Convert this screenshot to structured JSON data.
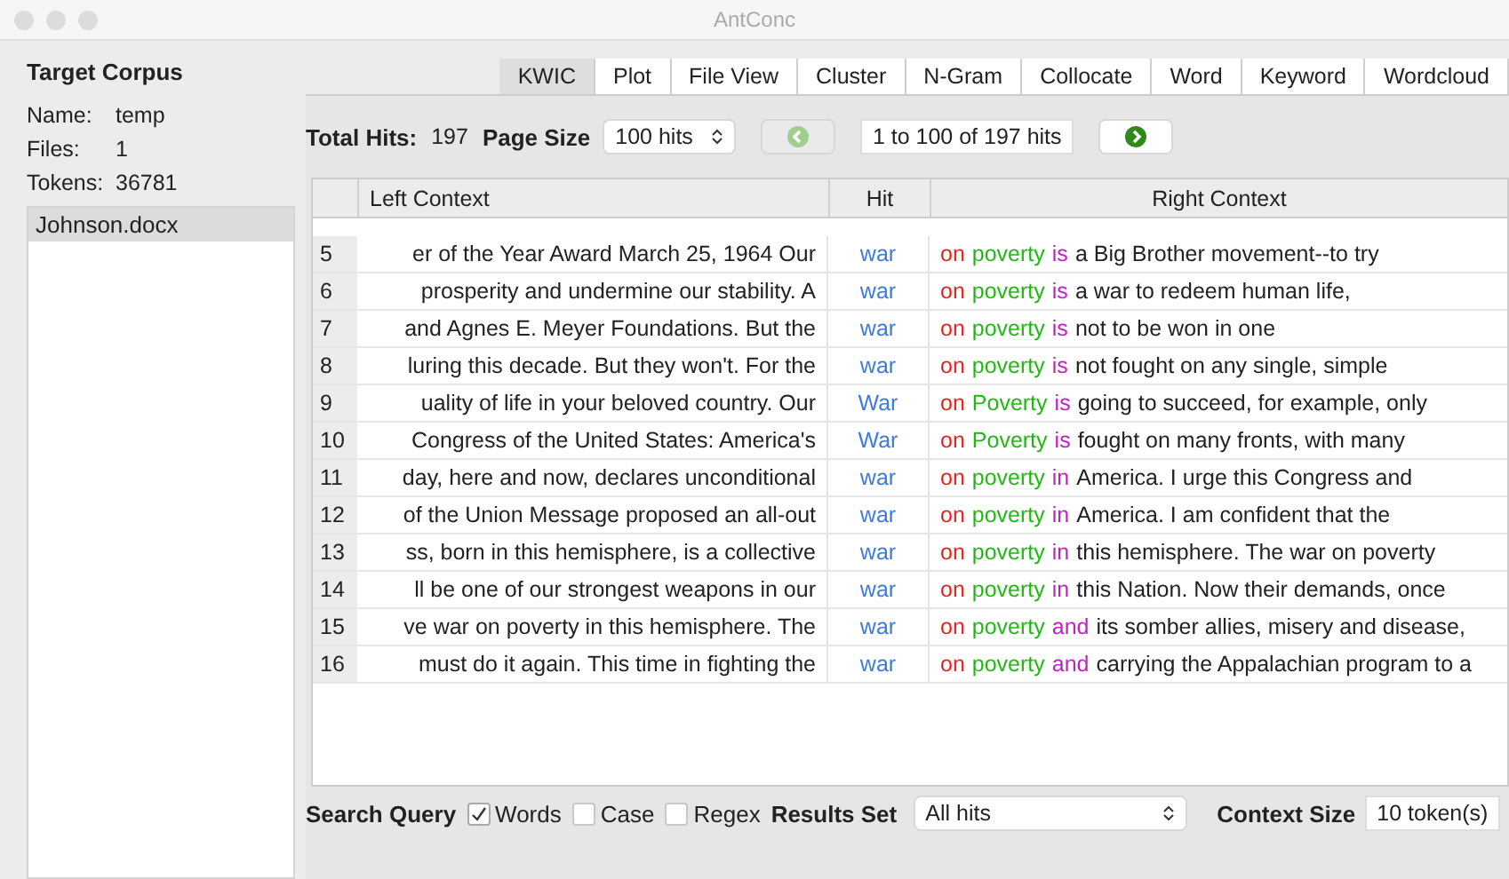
{
  "window": {
    "title": "AntConc"
  },
  "corpus": {
    "heading": "Target Corpus",
    "fields": [
      {
        "label": "Name:",
        "value": "temp"
      },
      {
        "label": "Files:",
        "value": "1"
      },
      {
        "label": "Tokens:",
        "value": "36781"
      }
    ],
    "files": [
      {
        "name": "Johnson.docx",
        "selected": true
      }
    ]
  },
  "tabs": [
    {
      "label": "KWIC",
      "selected": true
    },
    {
      "label": "Plot",
      "selected": false
    },
    {
      "label": "File View",
      "selected": false
    },
    {
      "label": "Cluster",
      "selected": false
    },
    {
      "label": "N-Gram",
      "selected": false
    },
    {
      "label": "Collocate",
      "selected": false
    },
    {
      "label": "Word",
      "selected": false
    },
    {
      "label": "Keyword",
      "selected": false
    },
    {
      "label": "Wordcloud",
      "selected": false
    }
  ],
  "hits_bar": {
    "total_label": "Total Hits:",
    "total": "197",
    "page_size_label": "Page Size",
    "page_size": "100 hits",
    "range": "1 to 100 of 197 hits",
    "prev_disabled": true,
    "next_disabled": false
  },
  "table": {
    "columns": [
      "Left Context",
      "Hit",
      "Right Context"
    ],
    "rows": [
      {
        "n": "5",
        "left": "er of the Year Award March 25, 1964 Our",
        "hit": "war",
        "right": [
          {
            "text": "on",
            "color": "#e8221c"
          },
          {
            "text": "poverty",
            "color": "#22b814"
          },
          {
            "text": "is",
            "color": "#c21fc4"
          }
        ],
        "rest": "a Big Brother movement--to try"
      },
      {
        "n": "6",
        "left": "prosperity and undermine our stability. A",
        "hit": "war",
        "right": [
          {
            "text": "on",
            "color": "#e8221c"
          },
          {
            "text": "poverty",
            "color": "#22b814"
          },
          {
            "text": "is",
            "color": "#c21fc4"
          }
        ],
        "rest": "a war to redeem human life,"
      },
      {
        "n": "7",
        "left": "and Agnes E. Meyer Foundations. But the",
        "hit": "war",
        "right": [
          {
            "text": "on",
            "color": "#e8221c"
          },
          {
            "text": "poverty",
            "color": "#22b814"
          },
          {
            "text": "is",
            "color": "#c21fc4"
          }
        ],
        "rest": "not to be won in one"
      },
      {
        "n": "8",
        "left": "luring this decade. But they won't. For the",
        "hit": "war",
        "right": [
          {
            "text": "on",
            "color": "#e8221c"
          },
          {
            "text": "poverty",
            "color": "#22b814"
          },
          {
            "text": "is",
            "color": "#c21fc4"
          }
        ],
        "rest": "not fought on any single, simple"
      },
      {
        "n": "9",
        "left": "uality of life in your beloved country. Our",
        "hit": "War",
        "right": [
          {
            "text": "on",
            "color": "#e8221c"
          },
          {
            "text": "Poverty",
            "color": "#22b814"
          },
          {
            "text": "is",
            "color": "#c21fc4"
          }
        ],
        "rest": "going to succeed, for example, only"
      },
      {
        "n": "10",
        "left": "Congress of the United States: America's",
        "hit": "War",
        "right": [
          {
            "text": "on",
            "color": "#e8221c"
          },
          {
            "text": "Poverty",
            "color": "#22b814"
          },
          {
            "text": "is",
            "color": "#c21fc4"
          }
        ],
        "rest": "fought on many fronts, with many"
      },
      {
        "n": "11",
        "left": "day, here and now, declares unconditional",
        "hit": "war",
        "right": [
          {
            "text": "on",
            "color": "#e8221c"
          },
          {
            "text": "poverty",
            "color": "#22b814"
          },
          {
            "text": "in",
            "color": "#c21fc4"
          }
        ],
        "rest": "America. I urge this Congress and"
      },
      {
        "n": "12",
        "left": "of the Union Message proposed an all-out",
        "hit": "war",
        "right": [
          {
            "text": "on",
            "color": "#e8221c"
          },
          {
            "text": "poverty",
            "color": "#22b814"
          },
          {
            "text": "in",
            "color": "#c21fc4"
          }
        ],
        "rest": "America. I am confident that the"
      },
      {
        "n": "13",
        "left": "ss, born in this hemisphere, is a collective",
        "hit": "war",
        "right": [
          {
            "text": "on",
            "color": "#e8221c"
          },
          {
            "text": "poverty",
            "color": "#22b814"
          },
          {
            "text": "in",
            "color": "#c21fc4"
          }
        ],
        "rest": "this hemisphere. The war on poverty"
      },
      {
        "n": "14",
        "left": "ll be one of our strongest weapons in our",
        "hit": "war",
        "right": [
          {
            "text": "on",
            "color": "#e8221c"
          },
          {
            "text": "poverty",
            "color": "#22b814"
          },
          {
            "text": "in",
            "color": "#c21fc4"
          }
        ],
        "rest": "this Nation. Now their demands, once"
      },
      {
        "n": "15",
        "left": "ve war on poverty in this hemisphere. The",
        "hit": "war",
        "right": [
          {
            "text": "on",
            "color": "#e8221c"
          },
          {
            "text": "poverty",
            "color": "#22b814"
          },
          {
            "text": "and",
            "color": "#c21fc4"
          }
        ],
        "rest": "its somber allies, misery and disease,"
      },
      {
        "n": "16",
        "left": "must do it again. This time in fighting the",
        "hit": "war",
        "right": [
          {
            "text": "on",
            "color": "#e8221c"
          },
          {
            "text": "poverty",
            "color": "#22b814"
          },
          {
            "text": "and",
            "color": "#c21fc4"
          }
        ],
        "rest": "carrying the Appalachian program to a"
      }
    ]
  },
  "search": {
    "label": "Search Query",
    "options": [
      {
        "label": "Words",
        "checked": true
      },
      {
        "label": "Case",
        "checked": false
      },
      {
        "label": "Regex",
        "checked": false
      }
    ],
    "results_label": "Results Set",
    "results": "All hits",
    "context_label": "Context Size",
    "context": "10 token(s)"
  }
}
